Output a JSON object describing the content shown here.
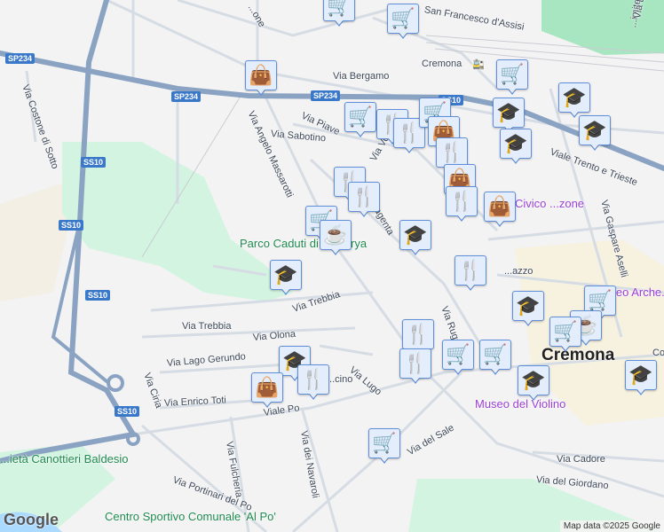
{
  "map": {
    "city_label": "Cremona",
    "station_label": "Cremona",
    "park_label": "Parco Caduti\ndi Nassirya",
    "poi_labels": [
      "Museo del Violino",
      "Civico ...zone",
      "...eo Arche... San"
    ],
    "road_shields": [
      "SP234",
      "SS10",
      "SP234",
      "SP234",
      "SS10",
      "SS10",
      "SS10",
      "SS10"
    ],
    "street_labels": [
      "Via Costone di Sotto",
      "Via Angelo Massarotti",
      "Via Bergamo",
      "Via Piave",
      "Via Sabotino",
      "Via Trebbia",
      "Via Trebbia",
      "Via Olona",
      "Via Lago Gerundo",
      "Via Ciria",
      "Via Enrico Toti",
      "Viale Po",
      "Via Fulcheria",
      "Via dei Navaroli",
      "Via Lugo",
      "Via del Sale",
      "Via Portinari del Po",
      "Viale Trento e Trieste",
      "Via Gaspare Aselli",
      "Via Ruggero",
      "Via Cadore",
      "Via del Giordano",
      "San Francesco d'Assisi",
      "Via Magenta",
      "Via Vo...",
      "...cino",
      "...one",
      "...imitero",
      "Via Dei C...",
      "...azzo",
      "Co..."
    ],
    "other_labels": [
      "...ietà Canottieri Baldesio",
      "Centro Sportivo Comunale 'Al Po'"
    ],
    "markers": [
      "cart",
      "cart",
      "bag",
      "cart",
      "graduation-cap",
      "graduation-cap",
      "cart",
      "food",
      "food",
      "cart",
      "bag",
      "graduation-cap",
      "graduation-cap",
      "food",
      "bag",
      "food",
      "food",
      "food",
      "bag",
      "cart",
      "coffee",
      "graduation-cap",
      "food",
      "graduation-cap",
      "cart",
      "coffee",
      "cart",
      "food",
      "cart",
      "food",
      "cart",
      "graduation-cap",
      "graduation-cap",
      "graduation-cap",
      "graduation-cap",
      "food",
      "bag",
      "cart"
    ],
    "colors": {
      "marker_fill": "#e3edfb",
      "marker_border": "#5f8fd8",
      "marker_icon": "#0c3c63",
      "highway": "#8aa3c2",
      "park": "#cdf3de",
      "poi": "#9a3fd6"
    }
  },
  "attribution": "Map data ©2025 Google",
  "logo": "Google"
}
